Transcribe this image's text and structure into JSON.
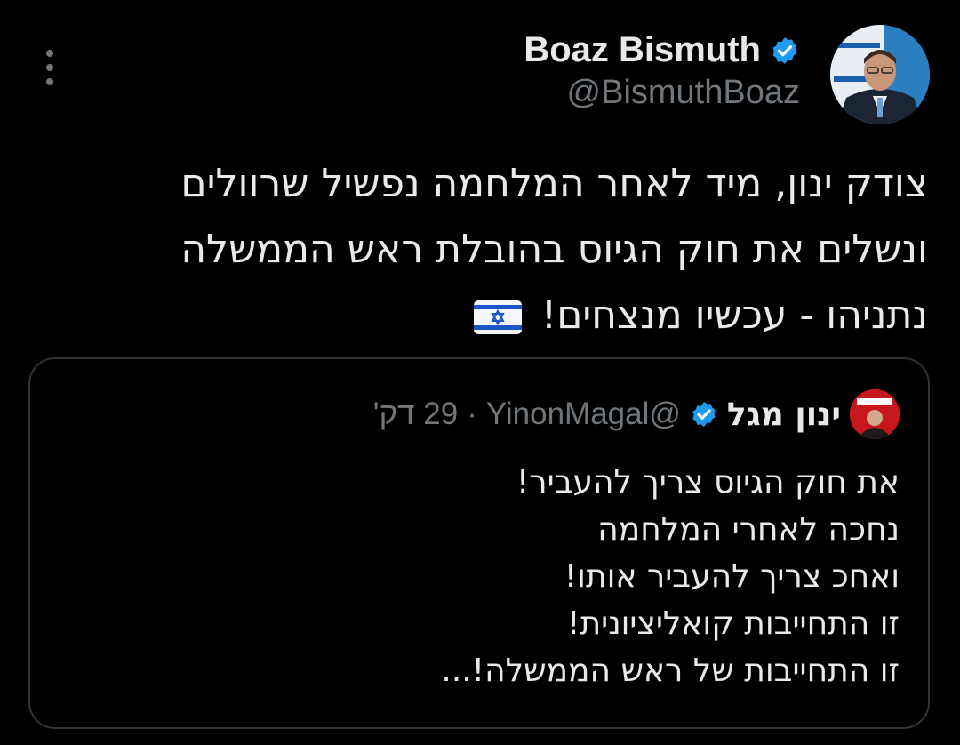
{
  "author": {
    "name": "Boaz Bismuth",
    "handle": "@BismuthBoaz",
    "verified_color": "#1d9bf0"
  },
  "tweet": {
    "lines": [
      "צודק ינון, מיד לאחר המלחמה נפשיל שרוולים",
      "ונשלים את חוק הגיוס בהובלת ראש הממשלה",
      "נתניהו - עכשיו מנצחים!"
    ],
    "emoji": "israel-flag"
  },
  "quoted_tweet": {
    "author_name": "ינון מגל",
    "handle": "@YinonMagal",
    "time": "29 דק'",
    "separator": "·",
    "lines": [
      "את חוק הגיוס צריך להעביר!",
      "נחכה לאחרי המלחמה",
      "ואחכ צריך להעביר אותו!",
      "זו התחייבות קואליציונית!",
      "זו התחייבות של ראש הממשלה!..."
    ]
  },
  "icons": {
    "more": "more-options-icon",
    "verified": "verified-badge-icon"
  }
}
